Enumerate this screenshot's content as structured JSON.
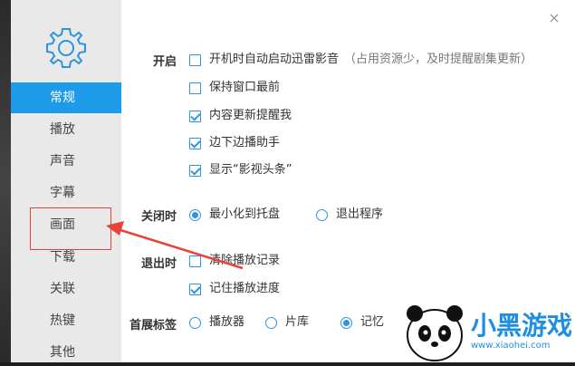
{
  "window": {
    "close_glyph": "×"
  },
  "sidebar": {
    "items": [
      {
        "label": "常规",
        "active": true
      },
      {
        "label": "播放",
        "active": false
      },
      {
        "label": "声音",
        "active": false
      },
      {
        "label": "字幕",
        "active": false
      },
      {
        "label": "画面",
        "active": false
      },
      {
        "label": "下载",
        "active": false
      },
      {
        "label": "关联",
        "active": false
      },
      {
        "label": "热键",
        "active": false
      },
      {
        "label": "其他",
        "active": false
      }
    ],
    "active_color": "#1d9be8"
  },
  "settings": {
    "startup": {
      "label": "开启",
      "options": [
        {
          "text": "开机时自动启动迅雷影音",
          "hint": "（占用资源少，及时提醒剧集更新）",
          "checked": false
        },
        {
          "text": "保持窗口最前",
          "checked": false
        },
        {
          "text": "内容更新提醒我",
          "checked": true
        },
        {
          "text": "边下边播助手",
          "checked": true
        },
        {
          "text": "显示“影视头条”",
          "checked": true
        }
      ]
    },
    "on_close": {
      "label": "关闭时",
      "options": [
        {
          "text": "最小化到托盘",
          "selected": true
        },
        {
          "text": "退出程序",
          "selected": false
        }
      ]
    },
    "on_exit": {
      "label": "退出时",
      "options": [
        {
          "text": "清除播放记录",
          "checked": false
        },
        {
          "text": "记住播放进度",
          "checked": true
        }
      ]
    },
    "home_tab": {
      "label": "首展标签",
      "options": [
        {
          "text": "播放器",
          "selected": false
        },
        {
          "text": "片库",
          "selected": false
        },
        {
          "text": "记忆",
          "selected": true
        }
      ]
    }
  },
  "annotation": {
    "color": "#e8413a"
  },
  "watermark": {
    "title": "小黑游戏",
    "url": "www.xiaohei.com"
  },
  "accent_color": "#2d95dd"
}
